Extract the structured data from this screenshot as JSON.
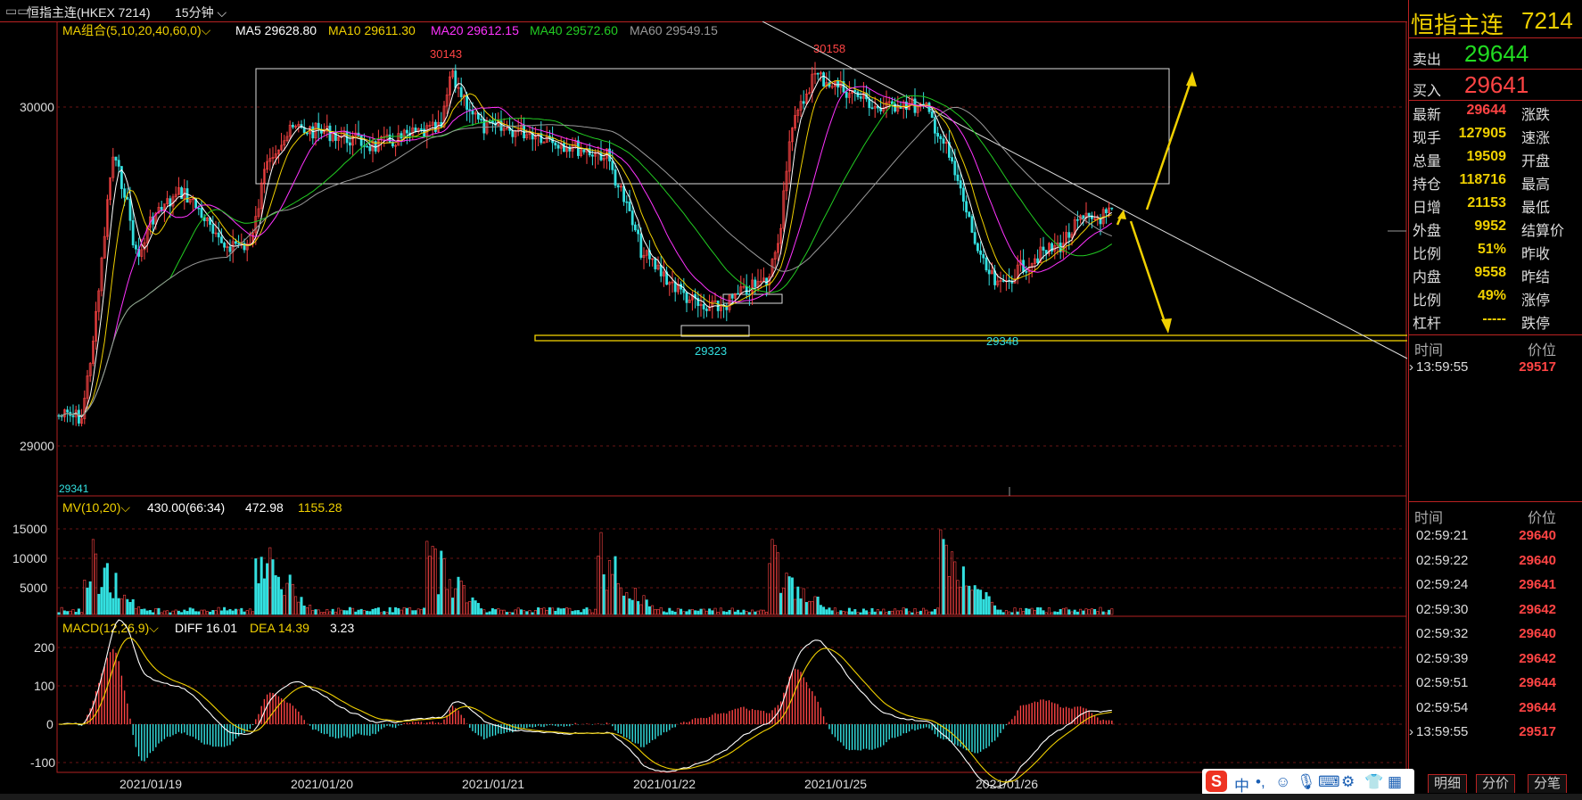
{
  "window": {
    "title": "恒指主连(HKEX 7214)",
    "period": "15分钟"
  },
  "ma_legend": {
    "label": "MA组合(5,10,20,40,60,0)",
    "ma5": "MA5 29628.80",
    "ma10": "MA10 29611.30",
    "ma20": "MA20 29612.15",
    "ma40": "MA40 29572.60",
    "ma60": "MA60 29549.15"
  },
  "price_axis": {
    "labels": [
      "30000",
      "29000"
    ]
  },
  "annotations": {
    "high1": "30143",
    "high2": "30158",
    "low1": "29323",
    "low2": "29348",
    "start": "29341"
  },
  "volume_legend": {
    "label": "MV(10,20)",
    "v1": "430.00(66:34)",
    "v2": "472.98",
    "v3": "1155.28"
  },
  "volume_axis": {
    "labels": [
      "15000",
      "10000",
      "5000"
    ]
  },
  "macd_legend": {
    "label": "MACD(12,26,9)",
    "diff": "DIFF 16.01",
    "dea": "DEA 14.39",
    "macd": "3.23"
  },
  "macd_axis": {
    "labels": [
      "200",
      "100",
      "0",
      "-100"
    ]
  },
  "date_axis": {
    "labels": [
      "2021/01/19",
      "2021/01/20",
      "2021/01/21",
      "2021/01/22",
      "2021/01/25",
      "2021/01/26"
    ]
  },
  "quote": {
    "name": "恒指主连",
    "code": "7214",
    "sell_label": "卖出",
    "sell": "29644",
    "buy_label": "买入",
    "buy": "29641",
    "rows": [
      {
        "l1": "最新",
        "v1": "29644",
        "c1": "#ff4444",
        "l2": "涨跌"
      },
      {
        "l1": "现手",
        "v1": "127905",
        "c1": "#f0d000",
        "l2": "速涨"
      },
      {
        "l1": "总量",
        "v1": "19509",
        "c1": "#f0d000",
        "l2": "开盘"
      },
      {
        "l1": "持仓",
        "v1": "118716",
        "c1": "#f0d000",
        "l2": "最高"
      },
      {
        "l1": "日增",
        "v1": "21153",
        "c1": "#f0d000",
        "l2": "最低"
      },
      {
        "l1": "外盘",
        "v1": "9952",
        "c1": "#f0d000",
        "l2": "结算价"
      },
      {
        "l1": "比例",
        "v1": "51%",
        "c1": "#f0d000",
        "l2": "昨收"
      },
      {
        "l1": "内盘",
        "v1": "9558",
        "c1": "#f0d000",
        "l2": "昨结"
      },
      {
        "l1": "比例",
        "v1": "49%",
        "c1": "#f0d000",
        "l2": "涨停"
      },
      {
        "l1": "杠杆",
        "v1": "-----",
        "c1": "#f0d000",
        "l2": "跌停"
      }
    ]
  },
  "ticks_top": {
    "time_label": "时间",
    "price_label": "价位",
    "rows": [
      {
        "time": "13:59:55",
        "price": "29517"
      }
    ]
  },
  "ticks_bottom": {
    "time_label": "时间",
    "price_label": "价位",
    "rows": [
      {
        "time": "02:59:21",
        "price": "29640"
      },
      {
        "time": "02:59:22",
        "price": "29640"
      },
      {
        "time": "02:59:24",
        "price": "29641"
      },
      {
        "time": "02:59:30",
        "price": "29642"
      },
      {
        "time": "02:59:32",
        "price": "29640"
      },
      {
        "time": "02:59:39",
        "price": "29642"
      },
      {
        "time": "02:59:51",
        "price": "29644"
      },
      {
        "time": "02:59:54",
        "price": "29644"
      },
      {
        "time": "13:59:55",
        "price": "29517"
      }
    ]
  },
  "tabs": [
    "明细",
    "分价",
    "分笔"
  ],
  "ime": {
    "logo": "S",
    "lang": "中"
  },
  "colors": {
    "up": "#ff4444",
    "down": "#33e0e0",
    "ma5": "#ffffff",
    "ma10": "#f0d000",
    "ma20": "#ff33ff",
    "ma40": "#22cc22",
    "ma60": "#999999",
    "accent": "#b22222"
  }
}
